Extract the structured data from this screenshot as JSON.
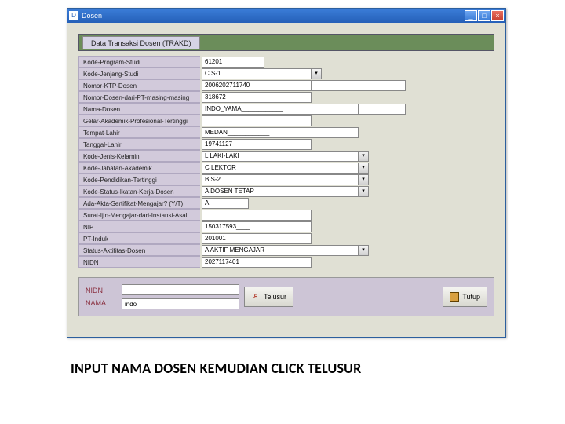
{
  "window": {
    "title": "Dosen",
    "min": "_",
    "max": "□",
    "close": "×"
  },
  "header": {
    "tab": "Data Transaksi Dosen (TRAKD)"
  },
  "fields": [
    {
      "label": "Kode-Program-Studi",
      "value": "61201",
      "width": "w80",
      "dropdown": false,
      "ext": 0
    },
    {
      "label": "Kode-Jenjang-Studi",
      "value": "C S-1",
      "width": "w140",
      "dropdown": true,
      "ext": 0
    },
    {
      "label": "Nomor-KTP-Dosen",
      "value": "2006202711740",
      "width": "w140",
      "dropdown": false,
      "ext": 120
    },
    {
      "label": "Nomor-Dosen-dari-PT-masing-masing",
      "value": "318672",
      "width": "w140",
      "dropdown": false,
      "ext": 0
    },
    {
      "label": "Nama-Dosen",
      "value": "INDO_YAMA____________",
      "width": "w200",
      "dropdown": false,
      "ext": 60
    },
    {
      "label": "Gelar-Akademik-Profesional-Tertinggi",
      "value": "",
      "width": "w140",
      "dropdown": false,
      "ext": 0
    },
    {
      "label": "Tempat-Lahir",
      "value": "MEDAN____________",
      "width": "w200",
      "dropdown": false,
      "ext": 0
    },
    {
      "label": "Tanggal-Lahir",
      "value": "19741127",
      "width": "w140",
      "dropdown": false,
      "ext": 0
    },
    {
      "label": "Kode-Jenis-Kelamin",
      "value": "L LAKI-LAKI",
      "width": "w200",
      "dropdown": true,
      "ext": 0
    },
    {
      "label": "Kode-Jabatan-Akademik",
      "value": "C LEKTOR",
      "width": "w200",
      "dropdown": true,
      "ext": 0
    },
    {
      "label": "Kode-Pendidikan-Tertinggi",
      "value": "B S-2",
      "width": "w200",
      "dropdown": true,
      "ext": 0
    },
    {
      "label": "Kode-Status-Ikatan-Kerja-Dosen",
      "value": "A DOSEN TETAP",
      "width": "w200",
      "dropdown": true,
      "ext": 0
    },
    {
      "label": "Ada-Akta-Sertifikat-Mengajar? (Y/T)",
      "value": "A",
      "width": "w60",
      "dropdown": false,
      "ext": 0
    },
    {
      "label": "Surat-Ijin-Mengajar-dari-Instansi-Asal",
      "value": "",
      "width": "w140",
      "dropdown": false,
      "ext": 0
    },
    {
      "label": "NIP",
      "value": "150317593____",
      "width": "w140",
      "dropdown": false,
      "ext": 0
    },
    {
      "label": "PT-Induk",
      "value": "201001",
      "width": "w140",
      "dropdown": false,
      "ext": 0
    },
    {
      "label": "Status-Aktifitas-Dosen",
      "value": "A AKTIF MENGAJAR",
      "width": "w200",
      "dropdown": true,
      "ext": 0
    },
    {
      "label": "NIDN",
      "value": "2027117401",
      "width": "w140",
      "dropdown": false,
      "ext": 0
    }
  ],
  "search": {
    "nidn_label": "NIDN",
    "nama_label": "NAMA",
    "nidn_value": "",
    "nama_value": "indo",
    "telusur": "Telusur",
    "tutup": "Tutup"
  },
  "caption": "INPUT NAMA DOSEN KEMUDIAN CLICK TELUSUR"
}
